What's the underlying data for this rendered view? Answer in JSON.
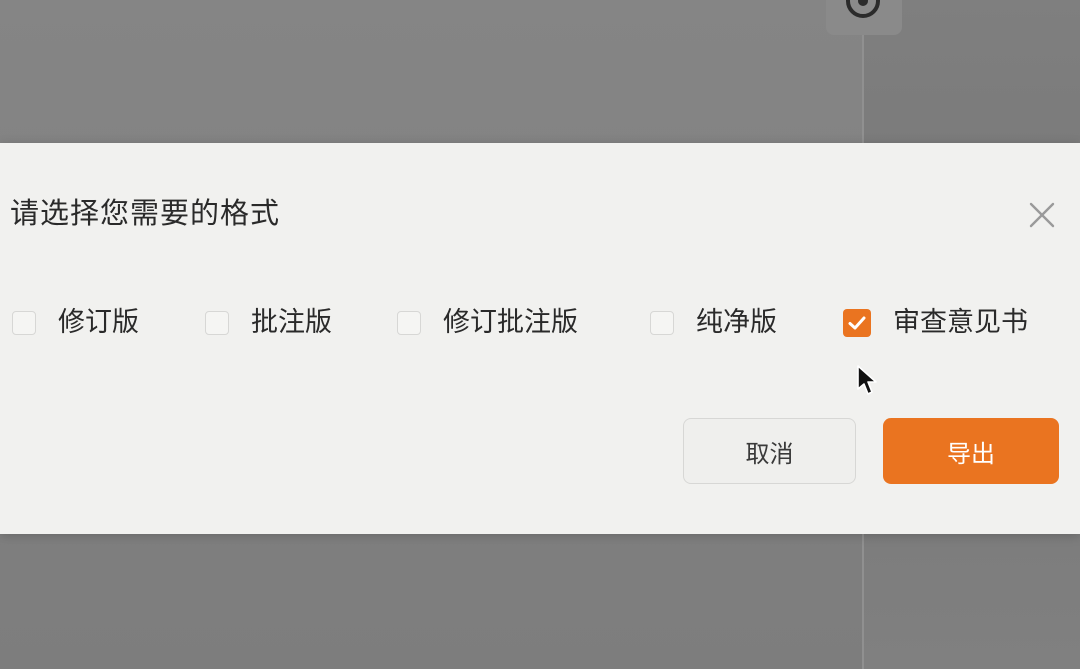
{
  "dialog": {
    "title": "请选择您需要的格式",
    "options": [
      {
        "label": "修订版",
        "checked": false
      },
      {
        "label": "批注版",
        "checked": false
      },
      {
        "label": "修订批注版",
        "checked": false
      },
      {
        "label": "纯净版",
        "checked": false
      },
      {
        "label": "审查意见书",
        "checked": true
      }
    ],
    "cancel_label": "取消",
    "export_label": "导出"
  },
  "icons": {
    "close": "close-icon",
    "check": "check-icon",
    "pointer": "mouse-pointer-icon",
    "top": "settings-icon"
  },
  "colors": {
    "accent": "#ea7420",
    "dialog_bg": "#f1f1ef",
    "backdrop": "#7f7f7f"
  }
}
